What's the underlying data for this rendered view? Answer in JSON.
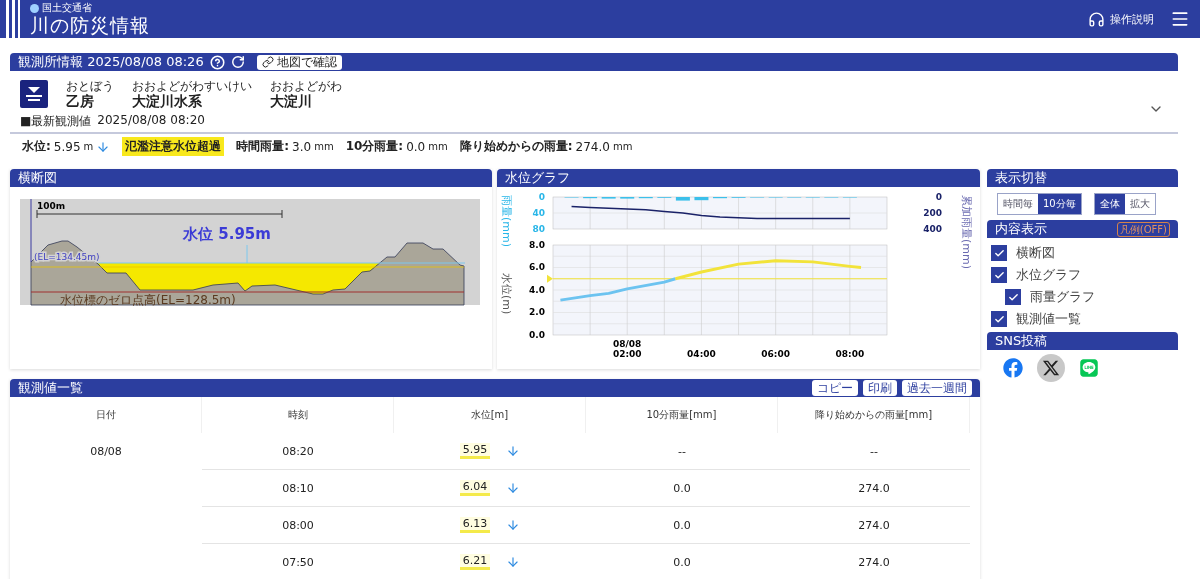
{
  "header": {
    "ministry": "国土交通省",
    "title": "川の防災情報",
    "help_label": "操作説明"
  },
  "station": {
    "title": "観測所情報 2025/08/08 08:26",
    "map_button": "地図で確認",
    "names": [
      {
        "reading": "おとぼう",
        "name": "乙房"
      },
      {
        "reading": "おおよどがわすいけい",
        "name": "大淀川水系"
      },
      {
        "reading": "おおよどがわ",
        "name": "大淀川"
      }
    ],
    "latest_label": "■最新観測値",
    "latest_time": "2025/08/08 08:20",
    "readings": [
      {
        "kind": "reading",
        "label": "水位:",
        "value": "5.95",
        "unit": "m",
        "falling": true
      },
      {
        "kind": "alert",
        "text": "氾濫注意水位超過"
      },
      {
        "kind": "reading",
        "label": "時間雨量:",
        "value": "3.0",
        "unit": "mm"
      },
      {
        "kind": "reading",
        "label": "10分雨量:",
        "value": "0.0",
        "unit": "mm"
      },
      {
        "kind": "reading",
        "label": "降り始めからの雨量:",
        "value": "274.0",
        "unit": "mm"
      }
    ]
  },
  "cross_section": {
    "title": "横断図",
    "scale_label": "100m",
    "level_label": "水位 5.95m",
    "bank_label": "(EL=134.45m)",
    "zero_label": "水位標のゼロ点高(EL=128.5m)"
  },
  "graph": {
    "title": "水位グラフ",
    "rain": {
      "chart_data": {
        "type": "bar",
        "ylabel": "雨量(mm)",
        "grid": true,
        "ylim": [
          80,
          0
        ],
        "yticks": [
          0,
          40,
          80
        ],
        "xlim": [
          0,
          9
        ],
        "x": [
          0.5,
          1,
          1.5,
          2,
          2.5,
          3,
          3.5,
          4,
          4.5,
          5,
          5.5,
          6,
          6.5,
          7,
          7.5,
          8
        ],
        "series": [
          {
            "color": "#3cc0ea",
            "values": [
              1,
              3,
              4,
              4,
              3,
              2,
              9,
              8,
              3,
              2,
              0,
              0,
              0,
              0,
              1,
              1
            ]
          }
        ]
      }
    },
    "cumulative": {
      "chart_data": {
        "type": "line",
        "ylabel": "累加雨量(mm)",
        "ylim": [
          400,
          0
        ],
        "yticks": [
          0,
          200,
          400
        ],
        "xlim": [
          0,
          9
        ],
        "x": [
          0.5,
          1,
          1.5,
          2,
          2.5,
          3,
          3.5,
          4,
          4.5,
          5,
          5.5,
          6,
          6.5,
          7,
          7.5,
          8
        ],
        "series": [
          {
            "color": "#1a2268",
            "values": [
              120,
              130,
              140,
              150,
              160,
              180,
              200,
              230,
              250,
              260,
              270,
              270,
              270,
              270,
              270,
              270
            ]
          }
        ]
      }
    },
    "level": {
      "chart_data": {
        "type": "line",
        "ylabel": "水位(m)",
        "grid": true,
        "ylim": [
          0,
          8
        ],
        "yticks": [
          {
            "value": 0,
            "label": "0.0"
          },
          {
            "value": 2,
            "label": "2.0"
          },
          {
            "value": 4,
            "label": "4.0"
          },
          {
            "value": 6,
            "label": "6.0"
          },
          {
            "value": 8,
            "label": "8.0"
          }
        ],
        "xlim": [
          0,
          9
        ],
        "xticks": [
          {
            "value": 2,
            "label": "02:00"
          },
          {
            "value": 4,
            "label": "04:00"
          },
          {
            "value": 6,
            "label": "06:00"
          },
          {
            "value": 8,
            "label": "08:00"
          }
        ],
        "x": [
          0.2,
          1,
          1.5,
          2,
          3,
          3.3,
          4,
          5,
          6,
          7,
          8,
          8.3
        ],
        "series": [
          {
            "color": "#6cc3f0",
            "values": [
              3.1,
              3.5,
              3.7,
              4.1,
              4.7,
              5.0,
              null,
              null,
              null,
              null,
              null,
              null
            ]
          },
          {
            "color": "#f2e33a",
            "values": [
              null,
              null,
              null,
              null,
              null,
              5.0,
              5.6,
              6.3,
              6.6,
              6.5,
              6.1,
              6.0
            ]
          }
        ],
        "ref_lines": [
          {
            "axis": "y",
            "value": 5.0
          }
        ],
        "annotations": [
          "08/08"
        ]
      }
    }
  },
  "display_switch": {
    "title": "表示切替",
    "interval": [
      {
        "label": "時間毎",
        "selected": false
      },
      {
        "label": "10分毎",
        "selected": true
      }
    ],
    "range": [
      {
        "label": "全体",
        "selected": true
      },
      {
        "label": "拡大",
        "selected": false
      }
    ]
  },
  "content": {
    "title": "内容表示",
    "legend_button": "凡例(OFF)",
    "items": [
      {
        "label": "横断図",
        "checked": true
      },
      {
        "label": "水位グラフ",
        "checked": true,
        "children": [
          {
            "label": "雨量グラフ",
            "checked": true
          }
        ]
      },
      {
        "label": "観測値一覧",
        "checked": true
      }
    ]
  },
  "sns": {
    "title": "SNS投稿",
    "links": [
      {
        "kind": "facebook"
      },
      {
        "kind": "x"
      },
      {
        "kind": "line"
      }
    ]
  },
  "table": {
    "title": "観測値一覧",
    "buttons": [
      "コピー",
      "印刷",
      "過去一週間"
    ],
    "columns": [
      "日付",
      "時刻",
      "水位[m]",
      "10分雨量[mm]",
      "降り始めからの雨量[mm]"
    ],
    "rows": [
      {
        "date": "08/08",
        "time": "08:20",
        "level": "5.95",
        "falling": true,
        "rain_10min": "--",
        "rain_total": "--"
      },
      {
        "time": "08:10",
        "level": "6.04",
        "falling": true,
        "rain_10min": "0.0",
        "rain_total": "274.0"
      },
      {
        "time": "08:00",
        "level": "6.13",
        "falling": true,
        "rain_10min": "0.0",
        "rain_total": "274.0"
      },
      {
        "time": "07:50",
        "level": "6.21",
        "falling": true,
        "rain_10min": "0.0",
        "rain_total": "274.0"
      }
    ]
  }
}
